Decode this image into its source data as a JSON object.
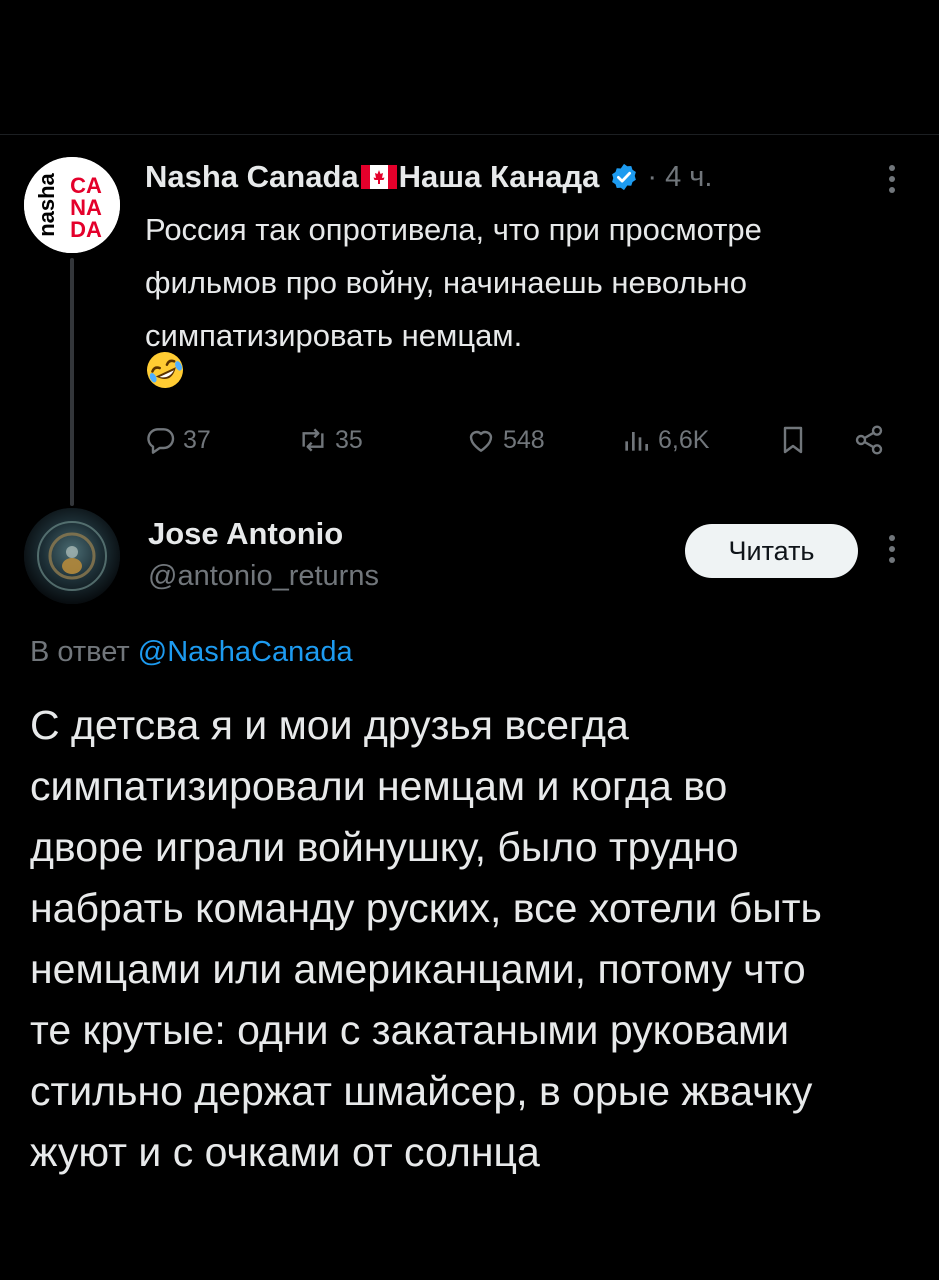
{
  "tweet": {
    "author": {
      "name_left": "Nasha Canada",
      "name_right": "Наша Канада",
      "time": "· 4 ч."
    },
    "text": "Россия так опротивела, что при просмотре\nфильмов про войну, начинаешь невольно\nсимпатизировать немцам.",
    "emoji": "rolling-on-floor-laughing",
    "stats": {
      "replies": "37",
      "reposts": "35",
      "likes": "548",
      "views": "6,6K"
    },
    "avatar_logo_text": [
      "nasha",
      "CA",
      "NA",
      "DA"
    ]
  },
  "reply": {
    "author": {
      "name": "Jose Antonio",
      "handle": "@antonio_returns"
    },
    "follow_label": "Читать",
    "reply_to_prefix": "В ответ",
    "reply_to_mention": "@NashaCanada",
    "text": "С детсва я и мои друзья всегда\nсимпатизировали немцам и когда во\nдворе играли войнушку, было трудно\nнабрать команду руских, все хотели быть\nнемцами или американцами, потому что\nте крутые: одни с закатаными руковами\nстильно держат шмайсер, в орые жвачку\nжуют и с очками от солнца"
  },
  "colors": {
    "background": "#000000",
    "text_primary": "#e7e9ea",
    "text_secondary": "#71767b",
    "accent": "#1d9bf0",
    "brand_red": "#e4002b",
    "button_bg": "#eff3f4"
  },
  "icons": [
    "more-icon",
    "verified-icon",
    "canada-flag-icon",
    "reply-icon",
    "repost-icon",
    "like-icon",
    "views-icon",
    "bookmark-icon",
    "share-icon"
  ]
}
